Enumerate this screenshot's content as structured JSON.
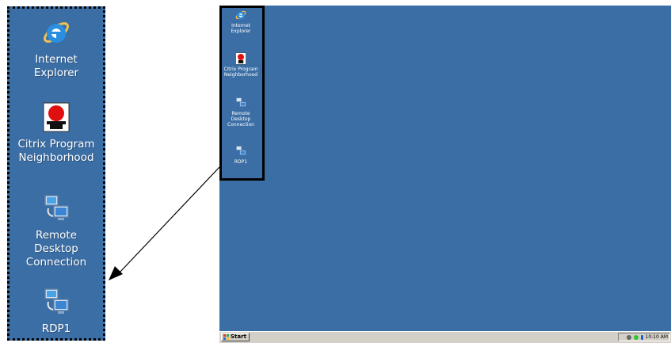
{
  "zoomed_panel": {
    "icons": [
      {
        "name": "ie-icon",
        "label": "Internet\nExplorer"
      },
      {
        "name": "citrix-icon",
        "label": "Citrix Program\nNeighborhood"
      },
      {
        "name": "remote-desktop-icon",
        "label": "Remote\nDesktop\nConnection"
      },
      {
        "name": "rdp-icon",
        "label": "RDP1"
      }
    ]
  },
  "desktop": {
    "icons": [
      {
        "name": "ie-icon",
        "label": "Internet\nExplorer"
      },
      {
        "name": "citrix-icon",
        "label": "Citrix Program\nNeighborhood"
      },
      {
        "name": "remote-desktop-icon",
        "label": "Remote\nDesktop\nConnection"
      },
      {
        "name": "rdp-icon",
        "label": "RDP1"
      }
    ],
    "taskbar": {
      "start_label": "Start",
      "clock": "10:10 AM"
    }
  },
  "colors": {
    "desktop_background": "#3b6ea5",
    "taskbar": "#d4d0c8",
    "highlight_border": "#000000"
  }
}
